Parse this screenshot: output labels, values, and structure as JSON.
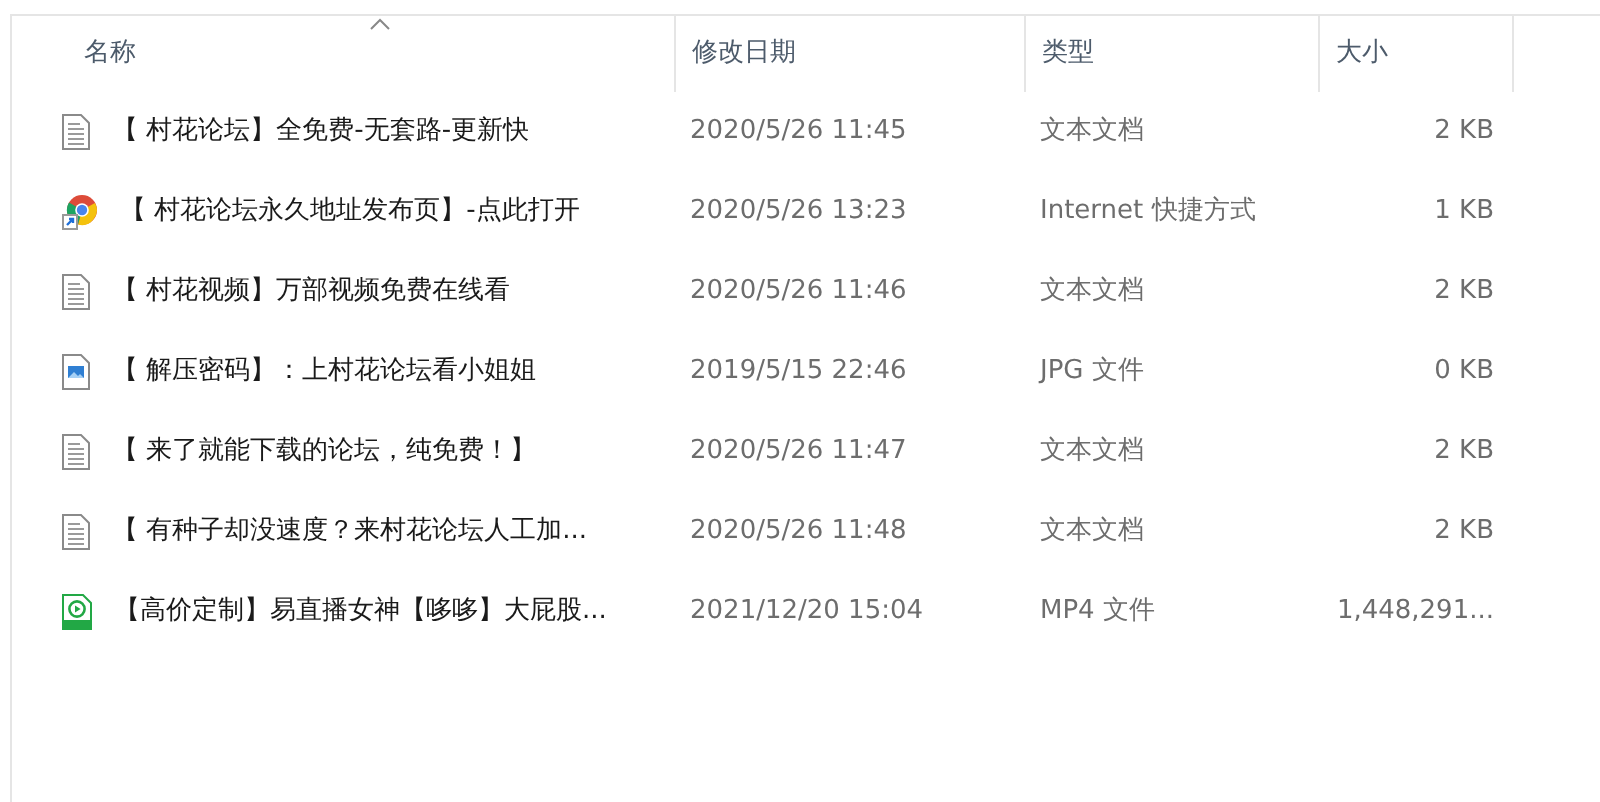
{
  "columns": [
    {
      "label": "名称",
      "sorted": true
    },
    {
      "label": "修改日期",
      "sorted": false
    },
    {
      "label": "类型",
      "sorted": false
    },
    {
      "label": "大小",
      "sorted": false
    }
  ],
  "files": [
    {
      "kind": "text",
      "name": "【 村花论坛】全免费-无套路-更新快",
      "modified": "2020/5/26 11:45",
      "type": "文本文档",
      "size": "2 KB"
    },
    {
      "kind": "shortcut",
      "name": "【 村花论坛永久地址发布页】-点此打开",
      "modified": "2020/5/26 13:23",
      "type": "Internet 快捷方式",
      "size": "1 KB"
    },
    {
      "kind": "text",
      "name": "【 村花视频】万部视频免费在线看",
      "modified": "2020/5/26 11:46",
      "type": "文本文档",
      "size": "2 KB"
    },
    {
      "kind": "image",
      "name": "【 解压密码】：上村花论坛看小姐姐",
      "modified": "2019/5/15 22:46",
      "type": "JPG 文件",
      "size": "0 KB"
    },
    {
      "kind": "text",
      "name": "【 来了就能下载的论坛，纯免费！】",
      "modified": "2020/5/26 11:47",
      "type": "文本文档",
      "size": "2 KB"
    },
    {
      "kind": "text",
      "name": "【 有种子却没速度？来村花论坛人工加...",
      "modified": "2020/5/26 11:48",
      "type": "文本文档",
      "size": "2 KB"
    },
    {
      "kind": "video",
      "name": "【高价定制】易直播女神【哆哆】大屁股...",
      "modified": "2021/12/20 15:04",
      "type": "MP4 文件",
      "size": "1,448,291..."
    }
  ]
}
